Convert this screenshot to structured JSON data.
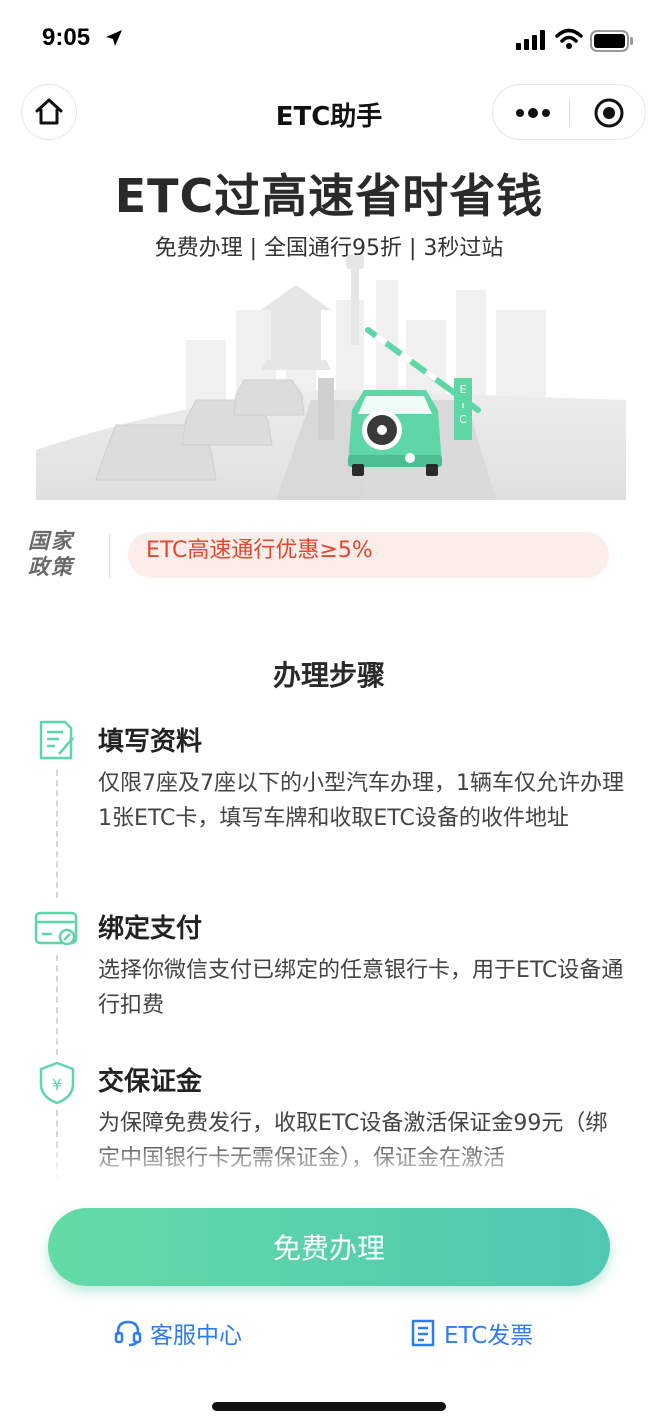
{
  "status_bar": {
    "time": "9:05"
  },
  "nav": {
    "title": "ETC助手"
  },
  "hero": {
    "title": "ETC过高速省时省钱",
    "subtitle": "免费办理 | 全国通行95折 | 3秒过站",
    "sign_text": "ETC"
  },
  "policy": {
    "logo_line1": "国家",
    "logo_line2": "政策",
    "text": "ETC高速通行优惠≥5%"
  },
  "steps": {
    "title": "办理步骤",
    "items": [
      {
        "title": "填写资料",
        "desc": "仅限7座及7座以下的小型汽车办理，1辆车仅允许办理1张ETC卡，填写车牌和收取ETC设备的收件地址",
        "icon": "form-edit-icon"
      },
      {
        "title": "绑定支付",
        "desc": "选择你微信支付已绑定的任意银行卡，用于ETC设备通行扣费",
        "icon": "card-link-icon"
      },
      {
        "title": "交保证金",
        "desc": "为保障免费发行，收取ETC设备激活保证金99元（绑定中国银行卡无需保证金），保证金在激活",
        "icon": "shield-yuan-icon"
      }
    ]
  },
  "cta": {
    "label": "免费办理"
  },
  "bottom_links": {
    "service": "客服中心",
    "invoice": "ETC发票"
  },
  "colors": {
    "accent_green": "#5fd6a8",
    "link_blue": "#2c7cf6",
    "policy_red": "#e2472f"
  }
}
